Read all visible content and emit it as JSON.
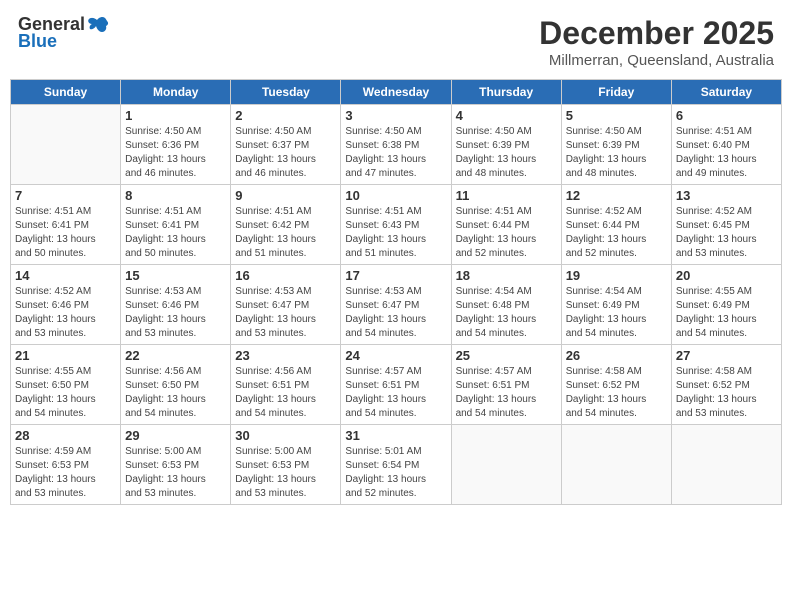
{
  "header": {
    "logo_general": "General",
    "logo_blue": "Blue",
    "month": "December 2025",
    "location": "Millmerran, Queensland, Australia"
  },
  "weekdays": [
    "Sunday",
    "Monday",
    "Tuesday",
    "Wednesday",
    "Thursday",
    "Friday",
    "Saturday"
  ],
  "weeks": [
    [
      {
        "day": "",
        "info": ""
      },
      {
        "day": "1",
        "info": "Sunrise: 4:50 AM\nSunset: 6:36 PM\nDaylight: 13 hours\nand 46 minutes."
      },
      {
        "day": "2",
        "info": "Sunrise: 4:50 AM\nSunset: 6:37 PM\nDaylight: 13 hours\nand 46 minutes."
      },
      {
        "day": "3",
        "info": "Sunrise: 4:50 AM\nSunset: 6:38 PM\nDaylight: 13 hours\nand 47 minutes."
      },
      {
        "day": "4",
        "info": "Sunrise: 4:50 AM\nSunset: 6:39 PM\nDaylight: 13 hours\nand 48 minutes."
      },
      {
        "day": "5",
        "info": "Sunrise: 4:50 AM\nSunset: 6:39 PM\nDaylight: 13 hours\nand 48 minutes."
      },
      {
        "day": "6",
        "info": "Sunrise: 4:51 AM\nSunset: 6:40 PM\nDaylight: 13 hours\nand 49 minutes."
      }
    ],
    [
      {
        "day": "7",
        "info": "Sunrise: 4:51 AM\nSunset: 6:41 PM\nDaylight: 13 hours\nand 50 minutes."
      },
      {
        "day": "8",
        "info": "Sunrise: 4:51 AM\nSunset: 6:41 PM\nDaylight: 13 hours\nand 50 minutes."
      },
      {
        "day": "9",
        "info": "Sunrise: 4:51 AM\nSunset: 6:42 PM\nDaylight: 13 hours\nand 51 minutes."
      },
      {
        "day": "10",
        "info": "Sunrise: 4:51 AM\nSunset: 6:43 PM\nDaylight: 13 hours\nand 51 minutes."
      },
      {
        "day": "11",
        "info": "Sunrise: 4:51 AM\nSunset: 6:44 PM\nDaylight: 13 hours\nand 52 minutes."
      },
      {
        "day": "12",
        "info": "Sunrise: 4:52 AM\nSunset: 6:44 PM\nDaylight: 13 hours\nand 52 minutes."
      },
      {
        "day": "13",
        "info": "Sunrise: 4:52 AM\nSunset: 6:45 PM\nDaylight: 13 hours\nand 53 minutes."
      }
    ],
    [
      {
        "day": "14",
        "info": "Sunrise: 4:52 AM\nSunset: 6:46 PM\nDaylight: 13 hours\nand 53 minutes."
      },
      {
        "day": "15",
        "info": "Sunrise: 4:53 AM\nSunset: 6:46 PM\nDaylight: 13 hours\nand 53 minutes."
      },
      {
        "day": "16",
        "info": "Sunrise: 4:53 AM\nSunset: 6:47 PM\nDaylight: 13 hours\nand 53 minutes."
      },
      {
        "day": "17",
        "info": "Sunrise: 4:53 AM\nSunset: 6:47 PM\nDaylight: 13 hours\nand 54 minutes."
      },
      {
        "day": "18",
        "info": "Sunrise: 4:54 AM\nSunset: 6:48 PM\nDaylight: 13 hours\nand 54 minutes."
      },
      {
        "day": "19",
        "info": "Sunrise: 4:54 AM\nSunset: 6:49 PM\nDaylight: 13 hours\nand 54 minutes."
      },
      {
        "day": "20",
        "info": "Sunrise: 4:55 AM\nSunset: 6:49 PM\nDaylight: 13 hours\nand 54 minutes."
      }
    ],
    [
      {
        "day": "21",
        "info": "Sunrise: 4:55 AM\nSunset: 6:50 PM\nDaylight: 13 hours\nand 54 minutes."
      },
      {
        "day": "22",
        "info": "Sunrise: 4:56 AM\nSunset: 6:50 PM\nDaylight: 13 hours\nand 54 minutes."
      },
      {
        "day": "23",
        "info": "Sunrise: 4:56 AM\nSunset: 6:51 PM\nDaylight: 13 hours\nand 54 minutes."
      },
      {
        "day": "24",
        "info": "Sunrise: 4:57 AM\nSunset: 6:51 PM\nDaylight: 13 hours\nand 54 minutes."
      },
      {
        "day": "25",
        "info": "Sunrise: 4:57 AM\nSunset: 6:51 PM\nDaylight: 13 hours\nand 54 minutes."
      },
      {
        "day": "26",
        "info": "Sunrise: 4:58 AM\nSunset: 6:52 PM\nDaylight: 13 hours\nand 54 minutes."
      },
      {
        "day": "27",
        "info": "Sunrise: 4:58 AM\nSunset: 6:52 PM\nDaylight: 13 hours\nand 53 minutes."
      }
    ],
    [
      {
        "day": "28",
        "info": "Sunrise: 4:59 AM\nSunset: 6:53 PM\nDaylight: 13 hours\nand 53 minutes."
      },
      {
        "day": "29",
        "info": "Sunrise: 5:00 AM\nSunset: 6:53 PM\nDaylight: 13 hours\nand 53 minutes."
      },
      {
        "day": "30",
        "info": "Sunrise: 5:00 AM\nSunset: 6:53 PM\nDaylight: 13 hours\nand 53 minutes."
      },
      {
        "day": "31",
        "info": "Sunrise: 5:01 AM\nSunset: 6:54 PM\nDaylight: 13 hours\nand 52 minutes."
      },
      {
        "day": "",
        "info": ""
      },
      {
        "day": "",
        "info": ""
      },
      {
        "day": "",
        "info": ""
      }
    ]
  ]
}
